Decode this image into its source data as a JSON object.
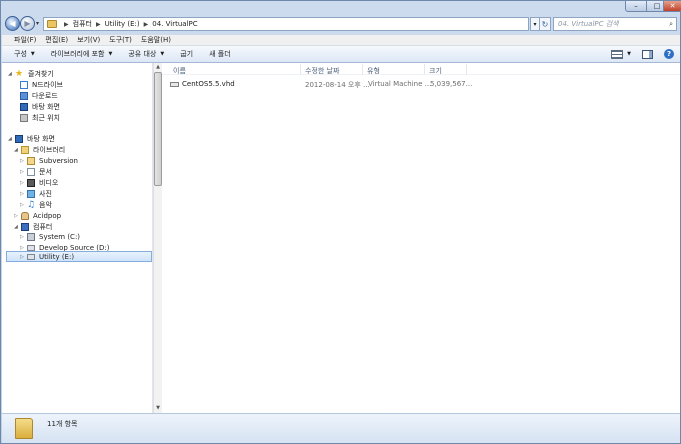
{
  "address": {
    "crumbs": [
      "컴퓨터",
      "Utility (E:)",
      "04. VirtualPC"
    ],
    "search_placeholder": "04. VirtualPC 검색"
  },
  "window_controls": {
    "minimize": "–",
    "maximize": "□",
    "close": "✕"
  },
  "menu": [
    "파일(F)",
    "편집(E)",
    "보기(V)",
    "도구(T)",
    "도움말(H)"
  ],
  "toolbar": {
    "organize": "구성",
    "include_library": "라이브러리에 포함",
    "share": "공유 대상",
    "burn": "굽기",
    "new_folder": "새 폴더"
  },
  "nav": {
    "favorites": {
      "label": "즐겨찾기",
      "items": [
        "N드라이브",
        "다운로드",
        "바탕 화면",
        "최근 위치"
      ]
    },
    "desktop": {
      "label": "바탕 화면",
      "library": {
        "label": "라이브러리",
        "items": [
          "Subversion",
          "문서",
          "비디오",
          "사진",
          "음악"
        ]
      },
      "user": "Acidpop",
      "computer": {
        "label": "컴퓨터",
        "drives": [
          "System (C:)",
          "Develop Source (D:)",
          "Utility (E:)"
        ]
      }
    }
  },
  "columns": {
    "name": "이름",
    "modified": "수정한 날짜",
    "type": "유형",
    "size": "크기"
  },
  "files": [
    {
      "name": "CentOS5.5.vhd",
      "modified": "2012-08-14 오후 ...",
      "type": "Virtual Machine ...",
      "size": "5,039,567..."
    }
  ],
  "status": {
    "count": "11개 항목"
  }
}
